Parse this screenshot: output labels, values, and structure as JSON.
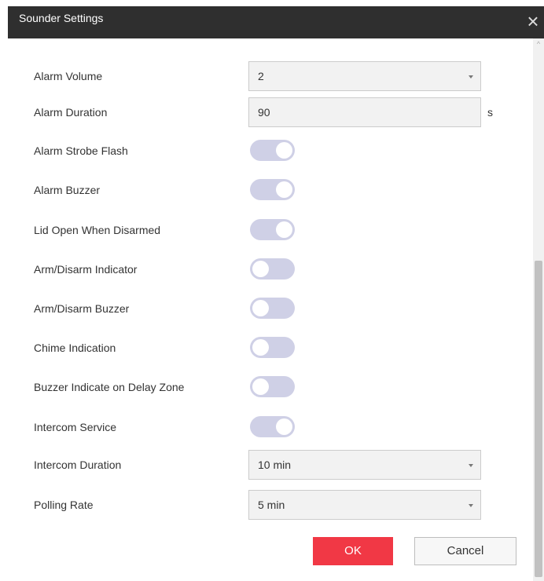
{
  "dialog": {
    "title": "Sounder Settings",
    "close_glyph": "×"
  },
  "fields": {
    "alarm_volume": {
      "label": "Alarm Volume",
      "value": "2"
    },
    "alarm_duration": {
      "label": "Alarm Duration",
      "value": "90",
      "unit": "s"
    },
    "intercom_duration": {
      "label": "Intercom Duration",
      "value": "10 min"
    },
    "polling_rate": {
      "label": "Polling Rate",
      "value": "5 min"
    }
  },
  "toggles": [
    {
      "label": "Alarm Strobe Flash",
      "on": true
    },
    {
      "label": "Alarm Buzzer",
      "on": true
    },
    {
      "label": "Lid Open When Disarmed",
      "on": true
    },
    {
      "label": "Arm/Disarm Indicator",
      "on": false
    },
    {
      "label": "Arm/Disarm Buzzer",
      "on": false
    },
    {
      "label": "Chime Indication",
      "on": false
    },
    {
      "label": "Buzzer Indicate on Delay Zone",
      "on": false
    },
    {
      "label": "Intercom Service",
      "on": true
    }
  ],
  "buttons": {
    "ok_label": "OK",
    "cancel_label": "Cancel"
  },
  "colors": {
    "accent": "#f13845",
    "toggle_track": "#cfd0e6",
    "titlebar": "#2f2f2f"
  }
}
